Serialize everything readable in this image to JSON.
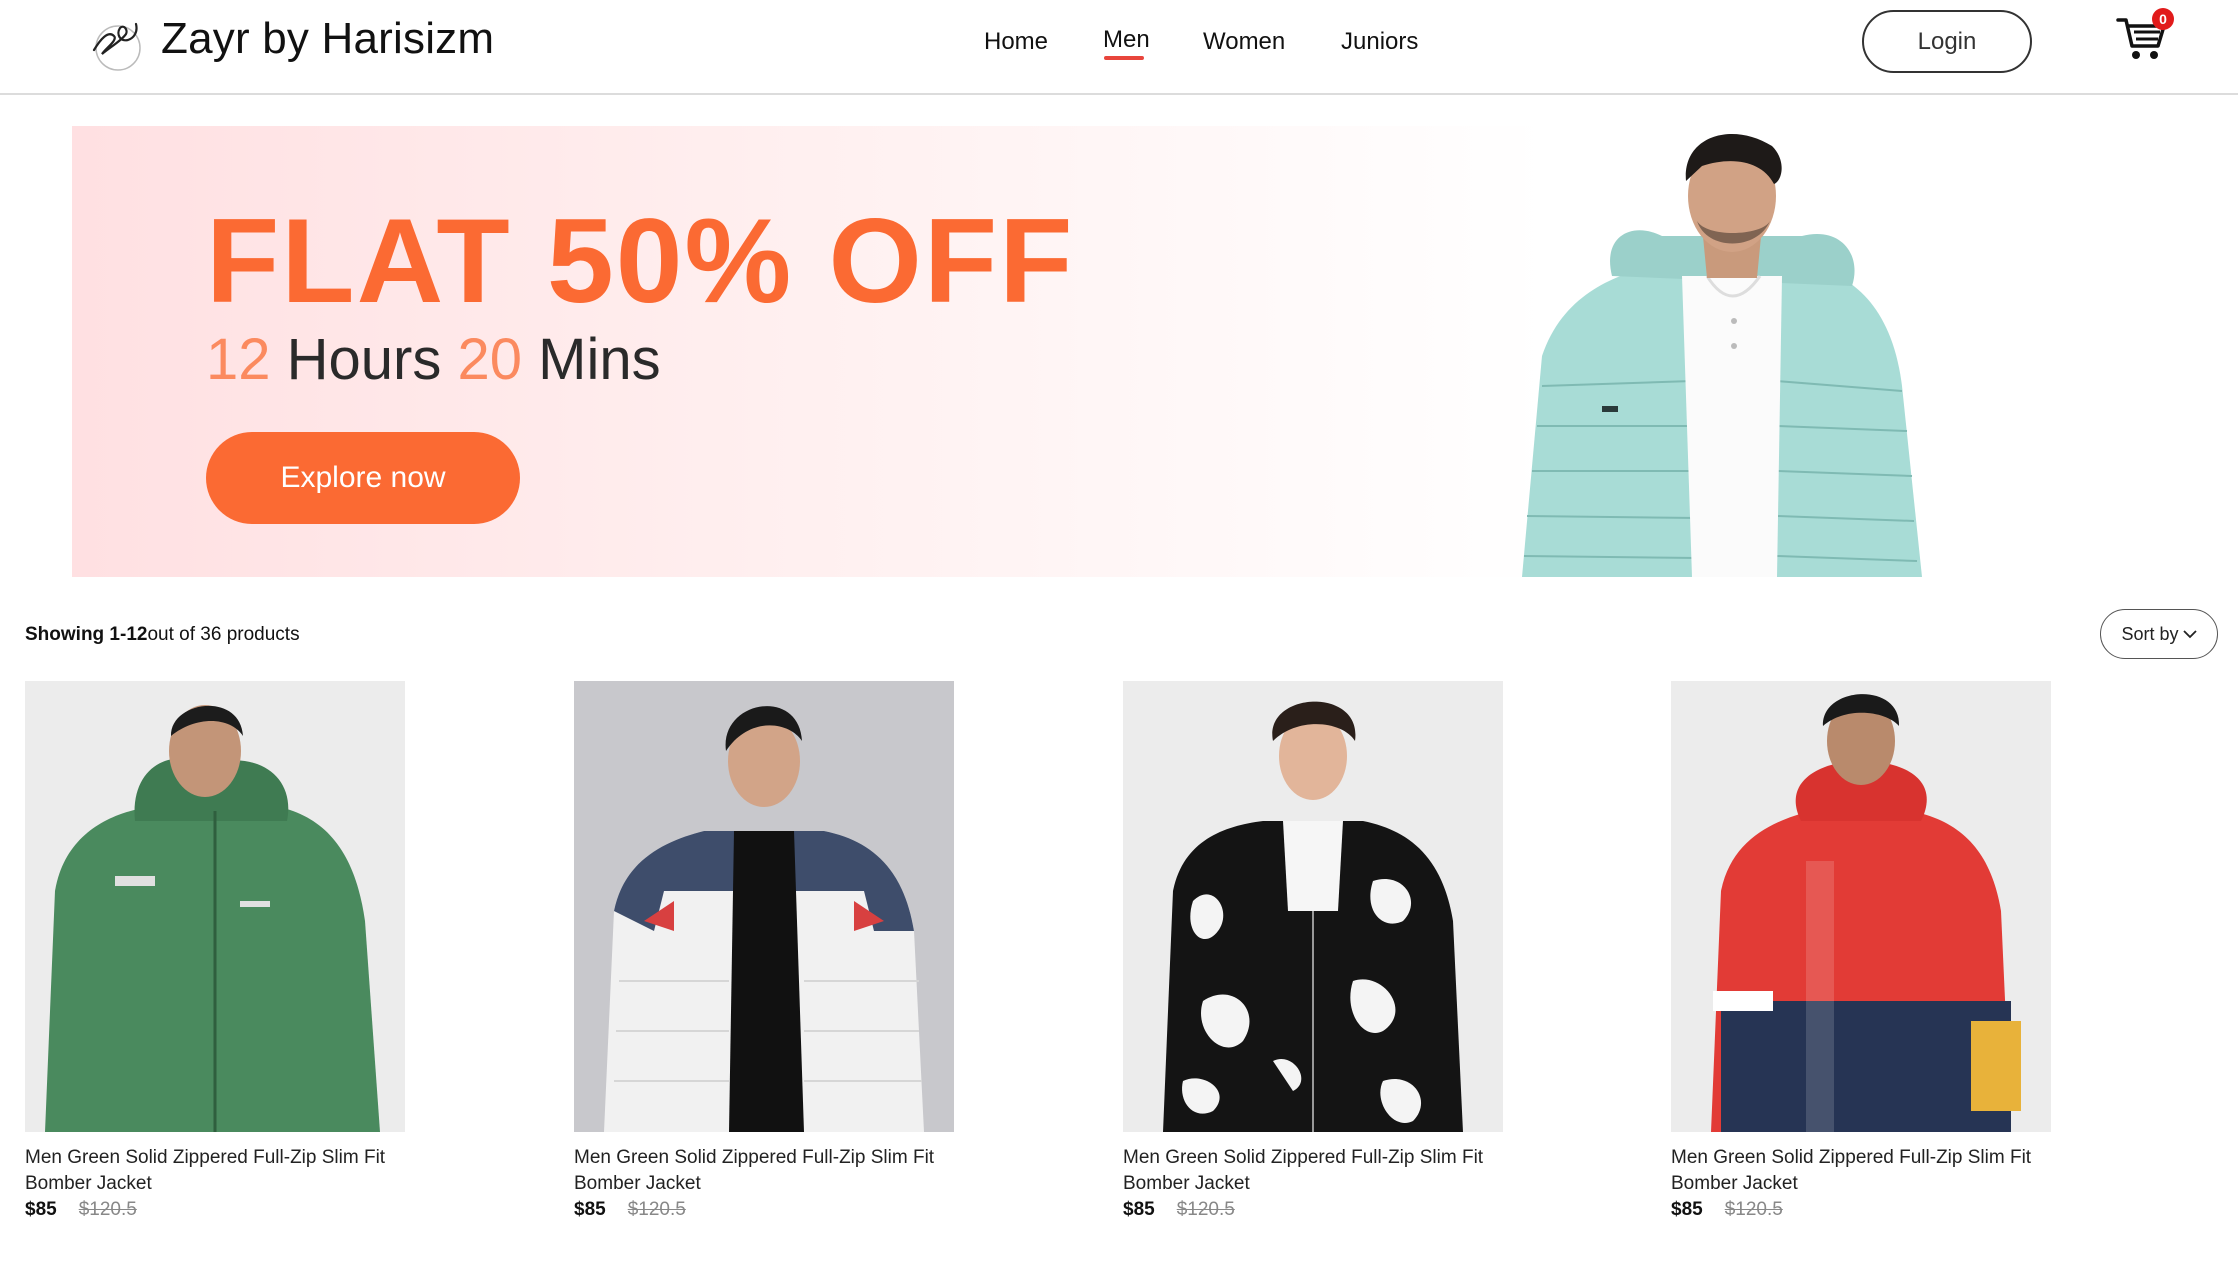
{
  "header": {
    "brand": "Zayr by Harisizm",
    "logo_icon": "signature-logo-icon",
    "nav": [
      "Home",
      "Men",
      "Women",
      "Juniors"
    ],
    "active_nav": "Men",
    "login_label": "Login",
    "cart_icon": "cart-icon",
    "cart_count": "0"
  },
  "banner": {
    "headline": "FLAT 50% OFF",
    "timer": {
      "hours": "12",
      "hours_label": "Hours",
      "mins": "20",
      "mins_label": "Mins"
    },
    "cta": "Explore now",
    "accent_color": "#fb6a33"
  },
  "listing": {
    "showing_range": "Showing 1-12",
    "showing_total": "out of 36 products",
    "sort_label": "Sort by",
    "sort_icon": "chevron-down-icon"
  },
  "products": [
    {
      "name": "Men Green Solid Zippered Full-Zip Slim Fit Bomber Jacket",
      "price": "$85",
      "old_price": "$120.5"
    },
    {
      "name": "Men Green Solid Zippered Full-Zip Slim Fit Bomber Jacket",
      "price": "$85",
      "old_price": "$120.5"
    },
    {
      "name": "Men Green Solid Zippered Full-Zip Slim Fit Bomber Jacket",
      "price": "$85",
      "old_price": "$120.5"
    },
    {
      "name": "Men Green Solid Zippered Full-Zip Slim Fit Bomber Jacket",
      "price": "$85",
      "old_price": "$120.5"
    }
  ]
}
